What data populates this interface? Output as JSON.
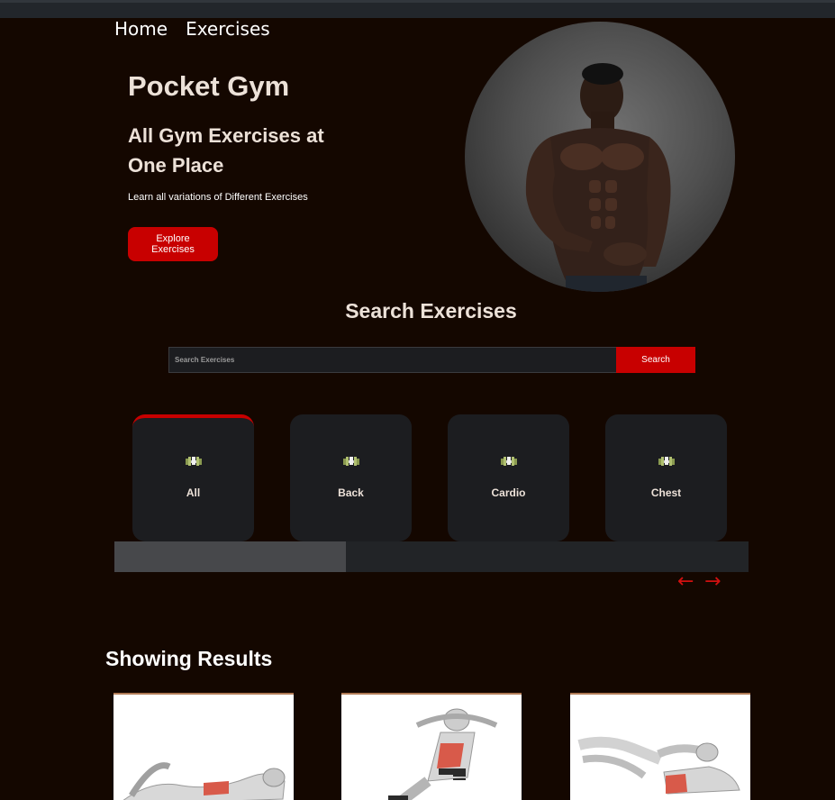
{
  "nav": {
    "home": "Home",
    "exercises": "Exercises"
  },
  "hero": {
    "title": "Pocket Gym",
    "subtitle": "All Gym Exercises at One Place",
    "description": "Learn all variations of Different Exercises",
    "cta": "Explore Exercises"
  },
  "search": {
    "title": "Search Exercises",
    "placeholder": "Search Exercises",
    "button": "Search"
  },
  "categories": [
    {
      "label": "All",
      "icon": "dumbbell-icon",
      "active": true
    },
    {
      "label": "Back",
      "icon": "dumbbell-icon",
      "active": false
    },
    {
      "label": "Cardio",
      "icon": "dumbbell-icon",
      "active": false
    },
    {
      "label": "Chest",
      "icon": "dumbbell-icon",
      "active": false
    }
  ],
  "pager": {
    "prev": "←",
    "next": "→"
  },
  "results": {
    "title": "Showing Results"
  },
  "colors": {
    "background": "#140700",
    "accent": "#c80000",
    "card": "#1c1d20"
  }
}
